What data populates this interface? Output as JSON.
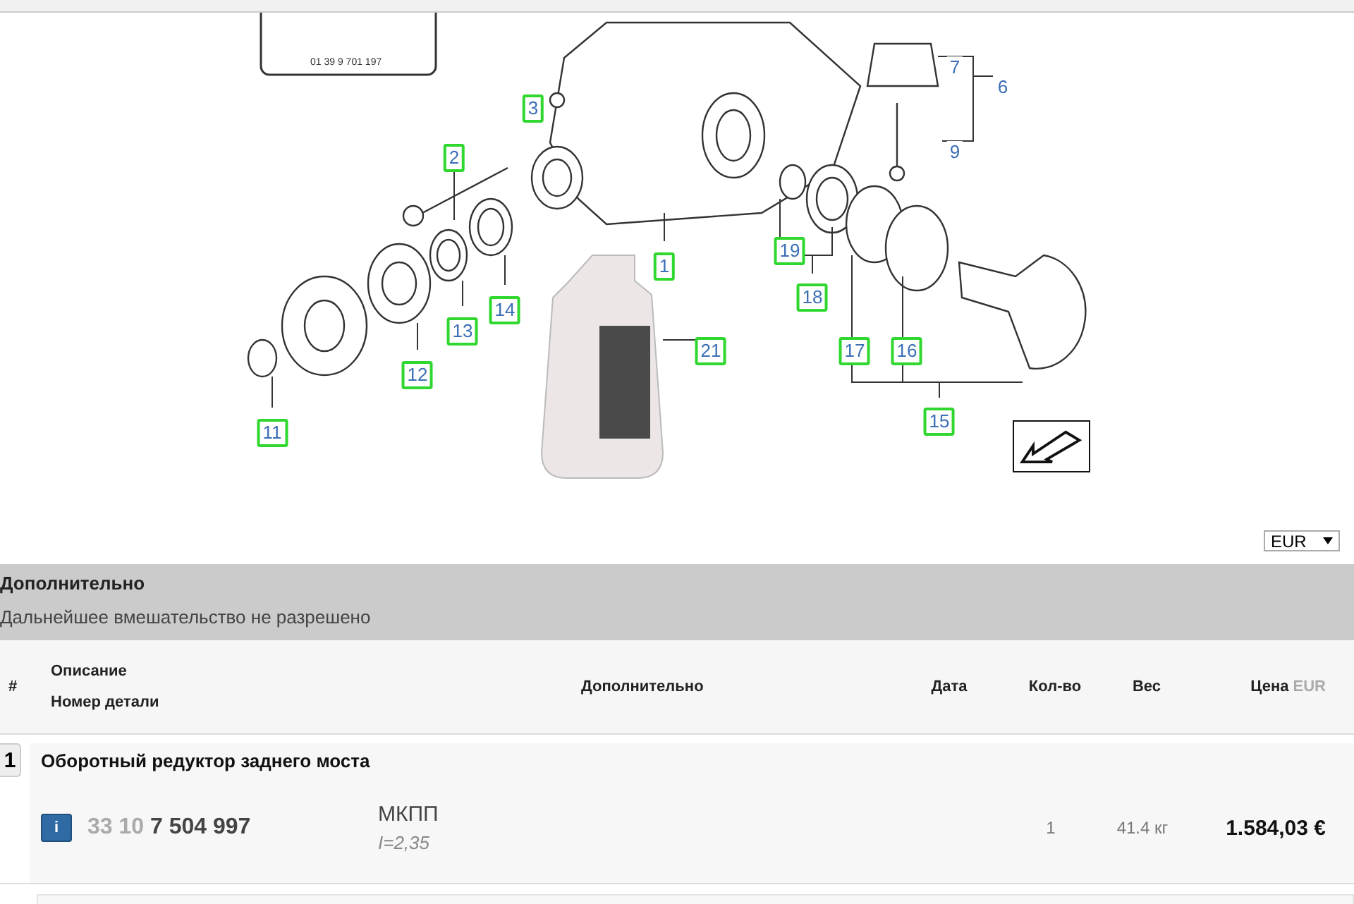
{
  "diagram": {
    "reference_card_text": "01 39 9 701 197",
    "callouts": [
      {
        "label": "3",
        "boxed": true
      },
      {
        "label": "2",
        "boxed": true
      },
      {
        "label": "1",
        "boxed": true
      },
      {
        "label": "19",
        "boxed": true
      },
      {
        "label": "18",
        "boxed": true
      },
      {
        "label": "21",
        "boxed": true
      },
      {
        "label": "14",
        "boxed": true
      },
      {
        "label": "13",
        "boxed": true
      },
      {
        "label": "12",
        "boxed": true
      },
      {
        "label": "11",
        "boxed": true
      },
      {
        "label": "17",
        "boxed": true
      },
      {
        "label": "16",
        "boxed": true
      },
      {
        "label": "15",
        "boxed": true
      },
      {
        "label": "7",
        "boxed": false
      },
      {
        "label": "6",
        "boxed": false
      },
      {
        "label": "9",
        "boxed": false
      }
    ]
  },
  "currency_select": {
    "value": "EUR"
  },
  "notice": {
    "title": "Дополнительно",
    "text": "Дальнейшее вмешательство не разрешено"
  },
  "table": {
    "columns": [
      {
        "kind": "num",
        "label": "#"
      },
      {
        "kind": "desc",
        "label": "Описание",
        "sublabel": "Номер детали"
      },
      {
        "kind": "extra",
        "label": "Дополнительно"
      },
      {
        "kind": "date",
        "label": "Дата"
      },
      {
        "kind": "qty",
        "label": "Кол-во"
      },
      {
        "kind": "weight",
        "label": "Вес"
      },
      {
        "kind": "price",
        "label": "Цена",
        "currency": "EUR"
      }
    ],
    "groups": [
      {
        "number": "1",
        "title": "Оборотный редуктор заднего моста",
        "items": [
          {
            "info": "i",
            "part_prefix": "33 10",
            "part_number": "7 504 997",
            "note": "МКПП",
            "subnote": "I=2,35",
            "qty": "1",
            "weight": "41.4 кг",
            "price": "1.584,03 €"
          }
        ]
      }
    ]
  }
}
